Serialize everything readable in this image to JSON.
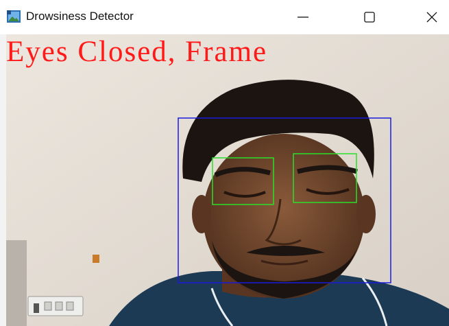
{
  "window": {
    "title": "Drowsiness Detector",
    "icon": "app-image-icon",
    "controls": {
      "minimize": "minimize-icon",
      "maximize": "maximize-icon",
      "close": "close-icon"
    }
  },
  "video": {
    "status_text": "Eyes Closed, Frame",
    "status_color": "#ff1a1a",
    "face_box_color": "#1a1adc",
    "eye_box_color": "#2adf2a",
    "detections": {
      "faces": 1,
      "eyes": 2
    }
  }
}
